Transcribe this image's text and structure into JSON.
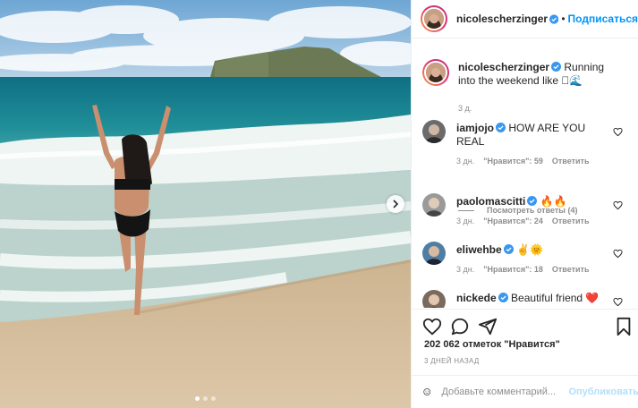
{
  "post": {
    "author": "nicolescherzinger",
    "follow_label": "Подписаться",
    "separator": "•",
    "caption": "Running into the weekend like 🏽🌊",
    "caption_time": "3 д.",
    "likes_text": "202 062 отметок \"Нравится\"",
    "date_text": "3 ДНЕЙ НАЗАД",
    "carousel": {
      "slides": 3,
      "active": 1
    }
  },
  "comments": [
    {
      "user": "iamjojo",
      "verified": true,
      "text": "HOW ARE YOU REAL",
      "time": "3 дн.",
      "likes": "\"Нравится\": 59",
      "reply": "Ответить"
    },
    {
      "user": "paolomascitti",
      "verified": true,
      "text": "🔥🔥",
      "time": "3 дн.",
      "likes": "\"Нравится\": 24",
      "reply": "Ответить"
    },
    {
      "user": "eliwehbe",
      "verified": true,
      "text": "✌️🌞",
      "time": "3 дн.",
      "likes": "\"Нравится\": 18",
      "reply": "Ответить"
    },
    {
      "user": "nickede",
      "verified": true,
      "text": "Beautiful friend ❤️",
      "time": "",
      "likes": "",
      "reply": ""
    }
  ],
  "view_replies": "Посмотреть ответы (4)",
  "add_comment": {
    "placeholder": "Добавьте комментарий...",
    "publish_label": "Опубликовать"
  },
  "icons": [
    "verified-icon",
    "heart-icon",
    "comment-icon",
    "share-icon",
    "bookmark-icon",
    "emoji-icon",
    "chevron-right-icon"
  ],
  "colors": {
    "accent": "#0095f6",
    "verified": "#3897f0",
    "muted": "#8e8e8e"
  }
}
